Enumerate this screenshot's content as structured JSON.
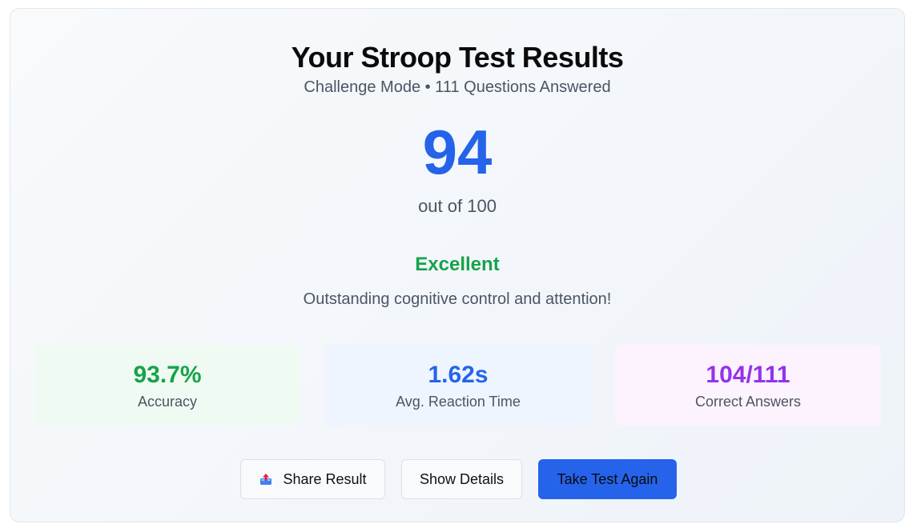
{
  "header": {
    "title": "Your Stroop Test Results",
    "subtitle": "Challenge Mode • 111 Questions Answered"
  },
  "score": {
    "value": "94",
    "out_of": "out of 100"
  },
  "rating": {
    "label": "Excellent",
    "message": "Outstanding cognitive control and attention!"
  },
  "stats": [
    {
      "value": "93.7%",
      "label": "Accuracy"
    },
    {
      "value": "1.62s",
      "label": "Avg. Reaction Time"
    },
    {
      "value": "104/111",
      "label": "Correct Answers"
    }
  ],
  "actions": {
    "share_label": "Share Result",
    "details_label": "Show Details",
    "again_label": "Take Test Again",
    "share_icon": "share-outbox-icon"
  },
  "colors": {
    "score": "#2563eb",
    "rating": "#16a34a",
    "accuracy": "#16a34a",
    "reaction": "#2563eb",
    "correct": "#9333ea",
    "primary_button": "#2563eb"
  }
}
